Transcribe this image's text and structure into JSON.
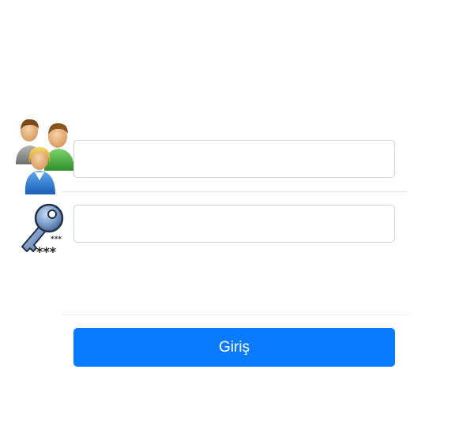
{
  "login_form": {
    "username": {
      "value": "",
      "placeholder": ""
    },
    "password": {
      "value": "",
      "placeholder": ""
    },
    "submit_label": "Giriş"
  },
  "icons": {
    "username": "users-group-icon",
    "password": "key-password-icon"
  },
  "colors": {
    "button_background": "#0a7bff",
    "button_text": "#ffffff",
    "input_border": "#cfd4da",
    "divider": "#e6e8eb",
    "page_background": "#ffffff"
  }
}
